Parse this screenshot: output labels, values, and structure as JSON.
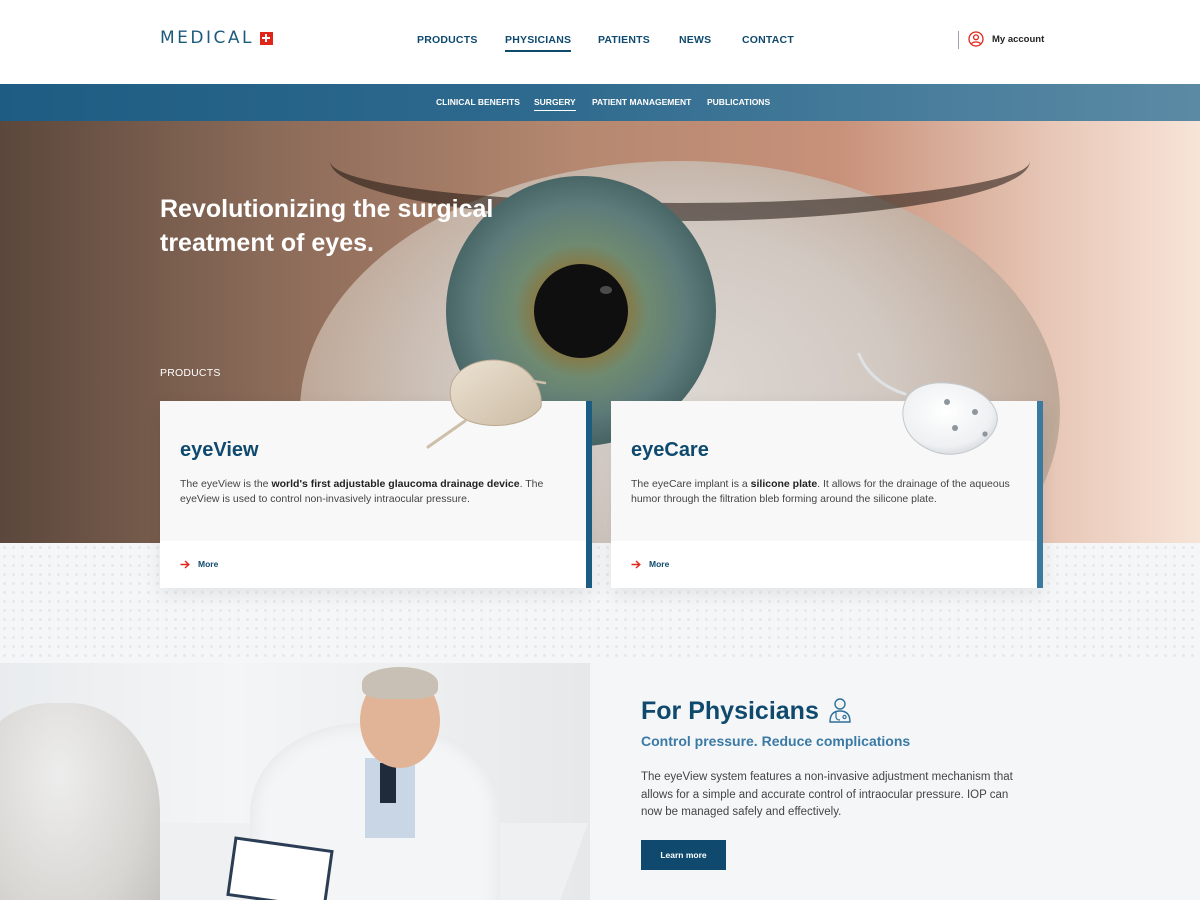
{
  "brand": {
    "name": "MEDICAL",
    "accent": "#e0261a",
    "primary": "#0f4a6e"
  },
  "nav": {
    "items": [
      {
        "label": "PRODUCTS"
      },
      {
        "label": "PHYSICIANS",
        "active": true
      },
      {
        "label": "PATIENTS"
      },
      {
        "label": "NEWS"
      },
      {
        "label": "CONTACT"
      }
    ],
    "account_label": "My account",
    "account_icon": "user-icon"
  },
  "subnav": {
    "items": [
      {
        "label": "CLINICAL BENEFITS"
      },
      {
        "label": "SURGERY",
        "active": true
      },
      {
        "label": "PATIENT MANAGEMENT"
      },
      {
        "label": "PUBLICATIONS"
      }
    ]
  },
  "hero": {
    "title": "Revolutionizing the surgical treatment of eyes.",
    "section_label": "PRODUCTS"
  },
  "cards": [
    {
      "title": "eyeView",
      "desc_pre": "The eyeView is the ",
      "desc_bold": "world's first adjustable glaucoma drainage device",
      "desc_post": ". The eyeView is used to control non-invasively intraocular pressure.",
      "more_label": "More",
      "more_icon": "arrow-right-icon"
    },
    {
      "title": "eyeCare",
      "desc_pre": "The eyeCare implant is a ",
      "desc_bold": "silicone plate",
      "desc_post": ". It allows for the drainage of the aqueous humor through the filtration bleb forming around the silicone plate.",
      "more_label": "More",
      "more_icon": "arrow-right-icon"
    }
  ],
  "physicians": {
    "title": "For Physicians",
    "icon": "doctor-icon",
    "subtitle": "Control pressure. Reduce complications",
    "text": "The eyeView system features a non-invasive adjustment mechanism that allows for a simple and accurate control of intraocular pressure. IOP can now be managed safely and effectively.",
    "button_label": "Learn more"
  }
}
